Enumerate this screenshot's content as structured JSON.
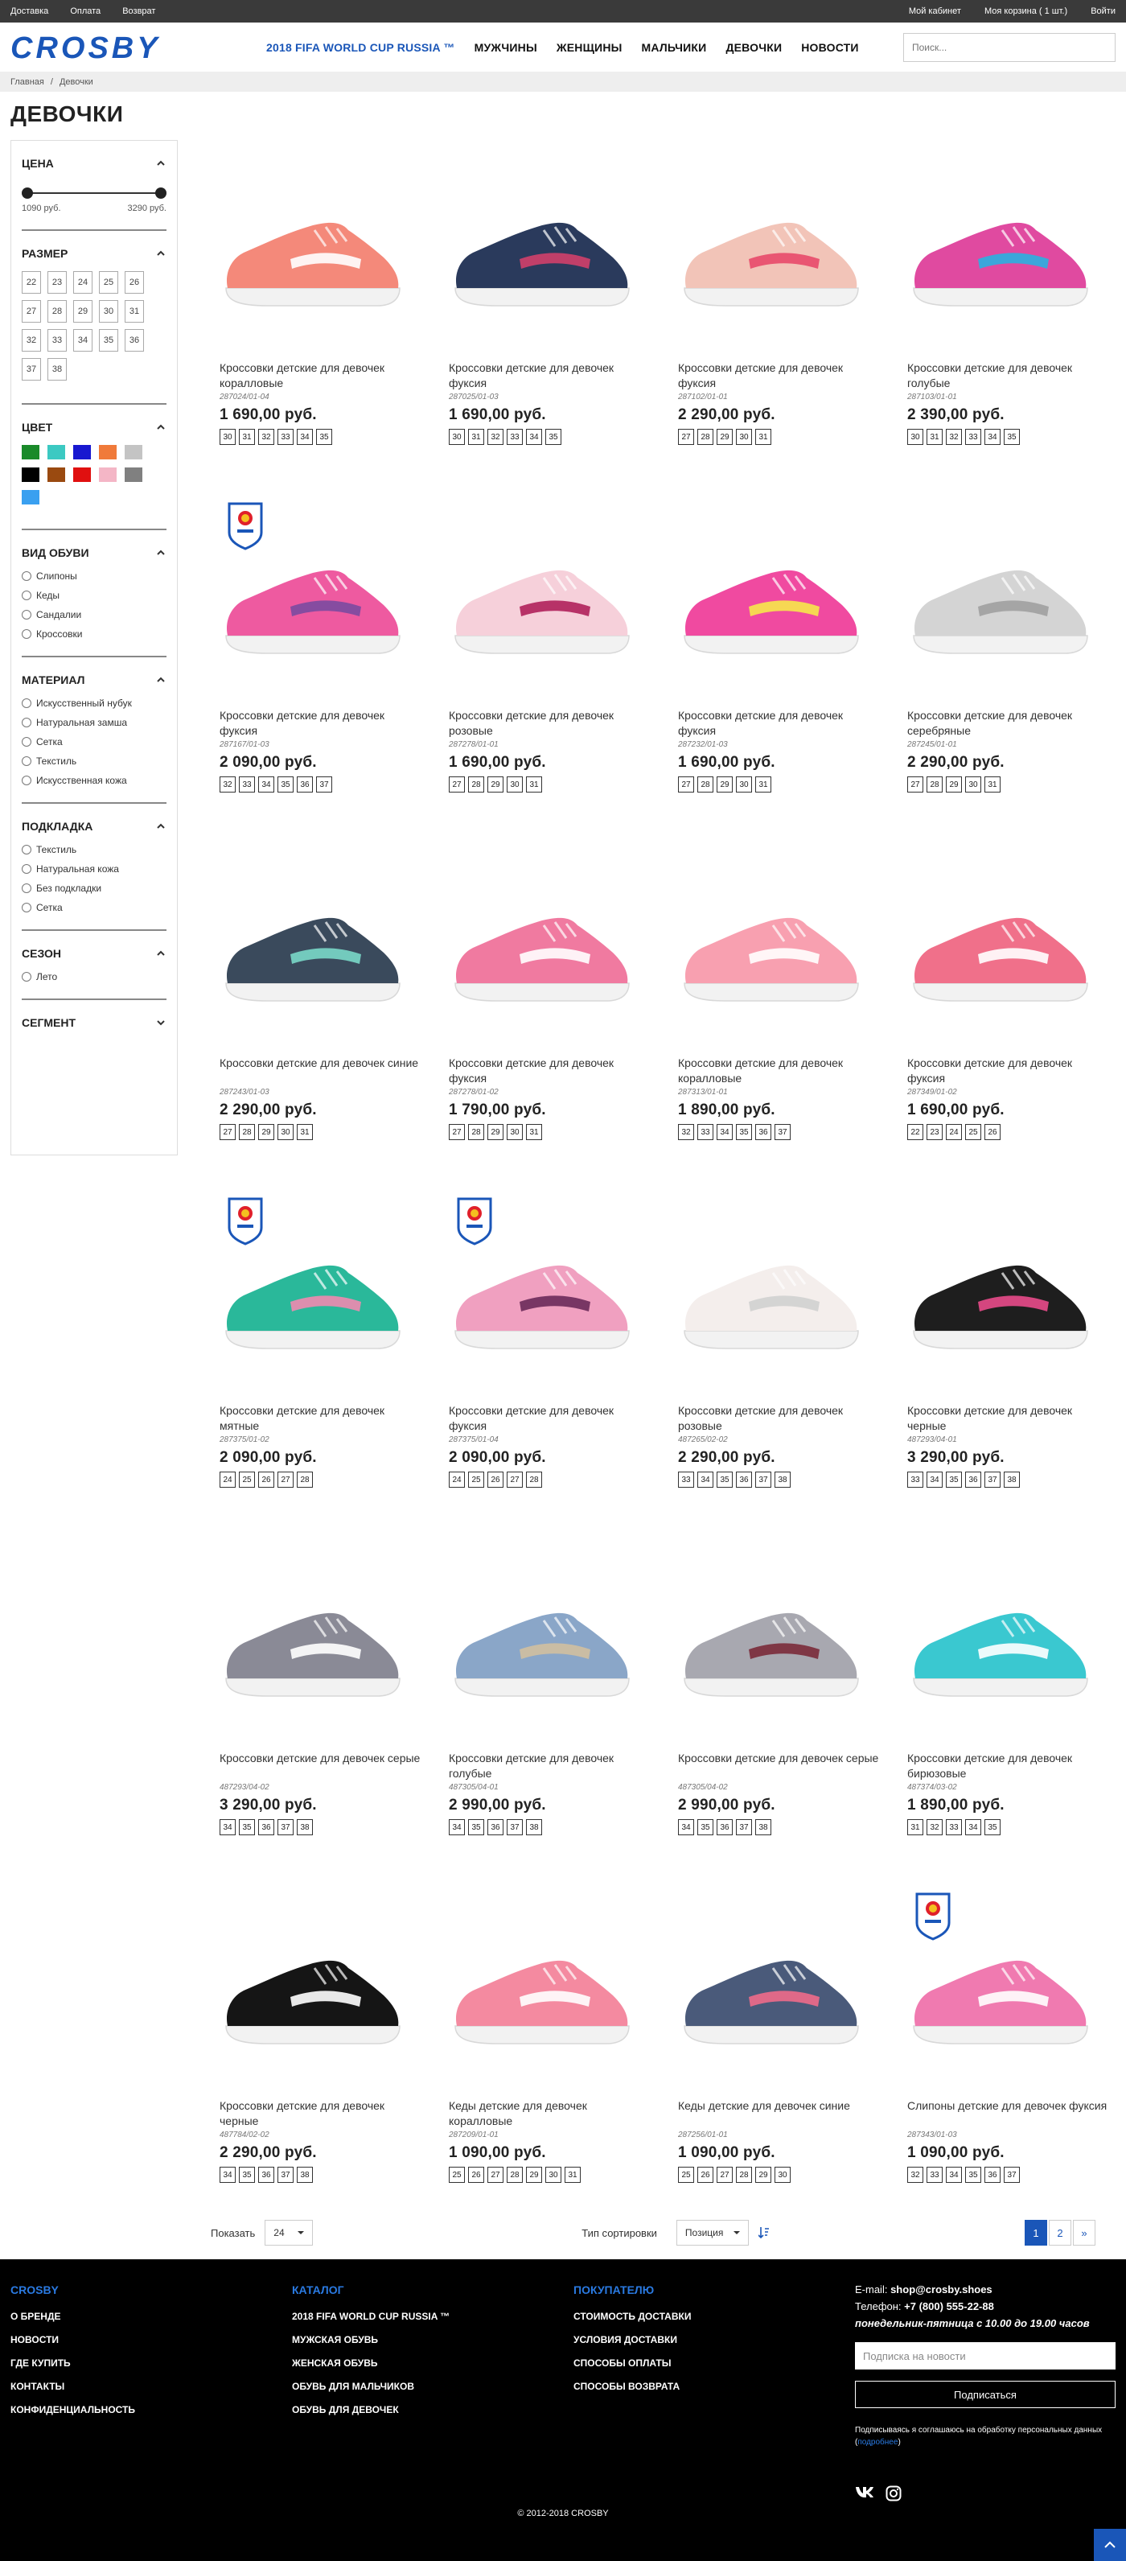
{
  "topbar": {
    "left": [
      "Доставка",
      "Оплата",
      "Возврат"
    ],
    "right": [
      "Мой кабинет",
      "Моя корзина ( 1 шт.)",
      "Войти"
    ]
  },
  "header": {
    "logo": "CROSBY",
    "nav": [
      "2018 FIFA WORLD CUP RUSSIA ™",
      "МУЖЧИНЫ",
      "ЖЕНЩИНЫ",
      "МАЛЬЧИКИ",
      "ДЕВОЧКИ",
      "НОВОСТИ"
    ],
    "search_placeholder": "Поиск..."
  },
  "breadcrumb": {
    "home": "Главная",
    "sep": "/",
    "current": "Девочки"
  },
  "page_title": "ДЕВОЧКИ",
  "filters": {
    "price": {
      "title": "ЦЕНА",
      "min": "1090 руб.",
      "max": "3290 руб."
    },
    "size": {
      "title": "РАЗМЕР",
      "values": [
        "22",
        "23",
        "24",
        "25",
        "26",
        "27",
        "28",
        "29",
        "30",
        "31",
        "32",
        "33",
        "34",
        "35",
        "36",
        "37",
        "38"
      ]
    },
    "color": {
      "title": "ЦВЕТ",
      "swatches": [
        "#1a8a2a",
        "#3cc9c2",
        "#1818d0",
        "#f07a3a",
        "#c4c4c4",
        "#000000",
        "#9a4a10",
        "#e01010",
        "#f4b6c6",
        "#808080",
        "#3aa0f0"
      ]
    },
    "type": {
      "title": "ВИД ОБУВИ",
      "options": [
        "Слипоны",
        "Кеды",
        "Сандалии",
        "Кроссовки"
      ]
    },
    "material": {
      "title": "МАТЕРИАЛ",
      "options": [
        "Искусственный нубук",
        "Натуральная замша",
        "Сетка",
        "Текстиль",
        "Искусственная кожа"
      ]
    },
    "lining": {
      "title": "ПОДКЛАДКА",
      "options": [
        "Текстиль",
        "Натуральная кожа",
        "Без подкладки",
        "Сетка"
      ]
    },
    "season": {
      "title": "СЕЗОН",
      "options": [
        "Лето"
      ]
    },
    "segment": {
      "title": "СЕГМЕНТ"
    }
  },
  "products": [
    {
      "name": "Кроссовки детские для девочек коралловые",
      "sku": "287024/01-04",
      "price": "1 690,00 руб.",
      "sizes": [
        "30",
        "31",
        "32",
        "33",
        "34",
        "35"
      ],
      "color": "#f4897a",
      "accent": "#ffffff",
      "badge": false
    },
    {
      "name": "Кроссовки детские для девочек фуксия",
      "sku": "287025/01-03",
      "price": "1 690,00 руб.",
      "sizes": [
        "30",
        "31",
        "32",
        "33",
        "34",
        "35"
      ],
      "color": "#2a3a5c",
      "accent": "#d0406a",
      "badge": false
    },
    {
      "name": "Кроссовки детские для девочек фуксия",
      "sku": "287102/01-01",
      "price": "2 290,00 руб.",
      "sizes": [
        "27",
        "28",
        "29",
        "30",
        "31"
      ],
      "color": "#f2c4b8",
      "accent": "#e84a6a",
      "badge": false
    },
    {
      "name": "Кроссовки детские для девочек голубые",
      "sku": "287103/01-01",
      "price": "2 390,00 руб.",
      "sizes": [
        "30",
        "31",
        "32",
        "33",
        "34",
        "35"
      ],
      "color": "#e04aa0",
      "accent": "#2ab0e0",
      "badge": false
    },
    {
      "name": "Кроссовки детские для девочек фуксия",
      "sku": "287167/01-03",
      "price": "2 090,00 руб.",
      "sizes": [
        "32",
        "33",
        "34",
        "35",
        "36",
        "37"
      ],
      "color": "#ee5aa0",
      "accent": "#7a4aa0",
      "badge": true
    },
    {
      "name": "Кроссовки детские для девочек розовые",
      "sku": "287278/01-01",
      "price": "1 690,00 руб.",
      "sizes": [
        "27",
        "28",
        "29",
        "30",
        "31"
      ],
      "color": "#f6d0da",
      "accent": "#b0205a",
      "badge": false
    },
    {
      "name": "Кроссовки детские для девочек фуксия",
      "sku": "287232/01-03",
      "price": "1 690,00 руб.",
      "sizes": [
        "27",
        "28",
        "29",
        "30",
        "31"
      ],
      "color": "#f04aa0",
      "accent": "#f6e84a",
      "badge": false
    },
    {
      "name": "Кроссовки детские для девочек серебряные",
      "sku": "287245/01-01",
      "price": "2 290,00 руб.",
      "sizes": [
        "27",
        "28",
        "29",
        "30",
        "31"
      ],
      "color": "#d4d4d4",
      "accent": "#a0a0a0",
      "badge": false
    },
    {
      "name": "Кроссовки детские для девочек синие",
      "sku": "287243/01-03",
      "price": "2 290,00 руб.",
      "sizes": [
        "27",
        "28",
        "29",
        "30",
        "31"
      ],
      "color": "#3a4a5c",
      "accent": "#7ad8c8",
      "badge": false
    },
    {
      "name": "Кроссовки детские для девочек фуксия",
      "sku": "287278/01-02",
      "price": "1 790,00 руб.",
      "sizes": [
        "27",
        "28",
        "29",
        "30",
        "31"
      ],
      "color": "#f07aa0",
      "accent": "#ffffff",
      "badge": false
    },
    {
      "name": "Кроссовки детские для девочек коралловые",
      "sku": "287313/01-01",
      "price": "1 890,00 руб.",
      "sizes": [
        "32",
        "33",
        "34",
        "35",
        "36",
        "37"
      ],
      "color": "#f8a0b0",
      "accent": "#ffffff",
      "badge": false
    },
    {
      "name": "Кроссовки детские для девочек фуксия",
      "sku": "287349/01-02",
      "price": "1 690,00 руб.",
      "sizes": [
        "22",
        "23",
        "24",
        "25",
        "26"
      ],
      "color": "#f0708a",
      "accent": "#ffffff",
      "badge": false
    },
    {
      "name": "Кроссовки детские для девочек мятные",
      "sku": "287375/01-02",
      "price": "2 090,00 руб.",
      "sizes": [
        "24",
        "25",
        "26",
        "27",
        "28"
      ],
      "color": "#2ab89a",
      "accent": "#f08ab0",
      "badge": true
    },
    {
      "name": "Кроссовки детские для девочек фуксия",
      "sku": "287375/01-04",
      "price": "2 090,00 руб.",
      "sizes": [
        "24",
        "25",
        "26",
        "27",
        "28"
      ],
      "color": "#f0a0c0",
      "accent": "#6a2a5a",
      "badge": true
    },
    {
      "name": "Кроссовки детские для девочек розовые",
      "sku": "487265/02-02",
      "price": "2 290,00 руб.",
      "sizes": [
        "33",
        "34",
        "35",
        "36",
        "37",
        "38"
      ],
      "color": "#f4eeec",
      "accent": "#d0d0d0",
      "badge": false
    },
    {
      "name": "Кроссовки детские для девочек черные",
      "sku": "487293/04-01",
      "price": "3 290,00 руб.",
      "sizes": [
        "33",
        "34",
        "35",
        "36",
        "37",
        "38"
      ],
      "color": "#1e1e1e",
      "accent": "#e84a8a",
      "badge": false
    },
    {
      "name": "Кроссовки детские для девочек серые",
      "sku": "487293/04-02",
      "price": "3 290,00 руб.",
      "sizes": [
        "34",
        "35",
        "36",
        "37",
        "38"
      ],
      "color": "#8a8a96",
      "accent": "#ffffff",
      "badge": false
    },
    {
      "name": "Кроссовки детские для девочек голубые",
      "sku": "487305/04-01",
      "price": "2 990,00 руб.",
      "sizes": [
        "34",
        "35",
        "36",
        "37",
        "38"
      ],
      "color": "#8aa6c8",
      "accent": "#d0c0a0",
      "badge": false
    },
    {
      "name": "Кроссовки детские для девочек серые",
      "sku": "487305/04-02",
      "price": "2 990,00 руб.",
      "sizes": [
        "34",
        "35",
        "36",
        "37",
        "38"
      ],
      "color": "#a8a8b0",
      "accent": "#7a2a3a",
      "badge": false
    },
    {
      "name": "Кроссовки детские для девочек бирюзовые",
      "sku": "487374/03-02",
      "price": "1 890,00 руб.",
      "sizes": [
        "31",
        "32",
        "33",
        "34",
        "35"
      ],
      "color": "#3ac8d0",
      "accent": "#ffffff",
      "badge": false
    },
    {
      "name": "Кроссовки детские для девочек черные",
      "sku": "487784/02-02",
      "price": "2 290,00 руб.",
      "sizes": [
        "34",
        "35",
        "36",
        "37",
        "38"
      ],
      "color": "#151515",
      "accent": "#ffffff",
      "badge": false
    },
    {
      "name": "Кеды детские для девочек коралловые",
      "sku": "287209/01-01",
      "price": "1 090,00 руб.",
      "sizes": [
        "25",
        "26",
        "27",
        "28",
        "29",
        "30",
        "31"
      ],
      "color": "#f48aa0",
      "accent": "#ffffff",
      "badge": false
    },
    {
      "name": "Кеды детские для девочек синие",
      "sku": "287256/01-01",
      "price": "1 090,00 руб.",
      "sizes": [
        "25",
        "26",
        "27",
        "28",
        "29",
        "30"
      ],
      "color": "#4a5a7a",
      "accent": "#f06a8a",
      "badge": false
    },
    {
      "name": "Слипоны детские для девочек фуксия",
      "sku": "287343/01-03",
      "price": "1 090,00 руб.",
      "sizes": [
        "32",
        "33",
        "34",
        "35",
        "36",
        "37"
      ],
      "color": "#f07ab0",
      "accent": "#ffffff",
      "badge": true
    }
  ],
  "toolbar": {
    "show_label": "Показать",
    "show_value": "24",
    "sort_label": "Тип сортировки",
    "sort_value": "Позиция",
    "pages": [
      "1",
      "2",
      "»"
    ]
  },
  "footer": {
    "crosby": {
      "title": "CROSBY",
      "links": [
        "О БРЕНДЕ",
        "НОВОСТИ",
        "ГДЕ КУПИТЬ",
        "КОНТАКТЫ",
        "КОНФИДЕНЦИАЛЬНОСТЬ"
      ]
    },
    "catalog": {
      "title": "КАТАЛОГ",
      "links": [
        "2018 FIFA WORLD CUP RUSSIA ™",
        "МУЖСКАЯ ОБУВЬ",
        "ЖЕНСКАЯ ОБУВЬ",
        "ОБУВЬ ДЛЯ МАЛЬЧИКОВ",
        "ОБУВЬ ДЛЯ ДЕВОЧЕК"
      ]
    },
    "buyer": {
      "title": "ПОКУПАТЕЛЮ",
      "links": [
        "СТОИМОСТЬ ДОСТАВКИ",
        "УСЛОВИЯ ДОСТАВКИ",
        "СПОСОБЫ ОПЛАТЫ",
        "СПОСОБЫ ВОЗВРАТА"
      ]
    },
    "email_label": "E-mail:",
    "email": "shop@crosby.shoes",
    "phone_label": "Телефон:",
    "phone": "+7 (800) 555-22-88",
    "hours": "понедельник-пятница с 10.00 до 19.00 часов",
    "subscribe_placeholder": "Подписка на новости",
    "subscribe_button": "Подписаться",
    "consent": "Подписываясь я соглашаюсь на обработку персональных данных",
    "consent_link": "подробнее",
    "copyright": "© 2012-2018 CROSBY"
  }
}
